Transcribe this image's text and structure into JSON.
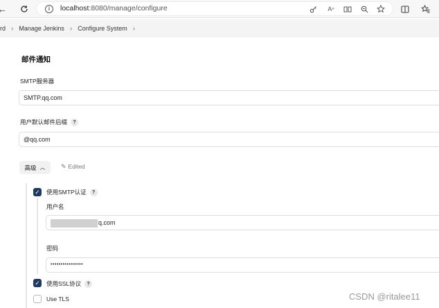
{
  "browser": {
    "url_host": "localhost",
    "url_path": ":8080/manage/configure"
  },
  "breadcrumb": {
    "items": [
      "rd",
      "Manage Jenkins",
      "Configure System"
    ]
  },
  "section": {
    "title": "邮件通知"
  },
  "smtp": {
    "label": "SMTP服务器",
    "value": "SMTP.qq.com"
  },
  "suffix": {
    "label": "用户默认邮件后缀",
    "value": "@qq.com"
  },
  "advanced": {
    "button_label": "高级",
    "edited_label": "Edited"
  },
  "smtp_auth": {
    "label": "使用SMTP认证",
    "checked": true,
    "username_label": "用户名",
    "username_value": "q.com",
    "password_label": "密码",
    "password_value": "••••••••••••••••"
  },
  "ssl": {
    "label": "使用SSL协议",
    "checked": true
  },
  "tls": {
    "label": "Use TLS",
    "checked": false
  },
  "help_glyph": "?",
  "watermark": "CSDN @ritalee11",
  "colors": {
    "checkbox_checked": "#1f3a5f",
    "breadcrumb_bg": "#f4f4f4"
  }
}
